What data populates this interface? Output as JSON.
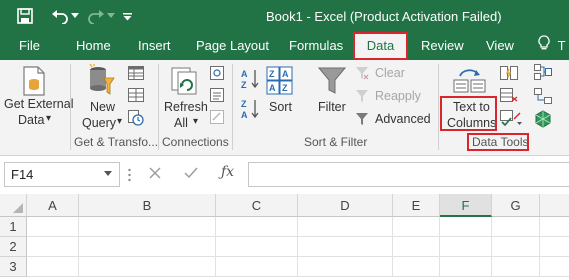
{
  "title_bar": {
    "title": "Book1 - Excel (Product Activation Failed)",
    "icons": [
      "save-icon",
      "undo-icon",
      "undo-dropdown-icon",
      "redo-icon",
      "redo-dropdown-icon",
      "customize-qat-icon"
    ]
  },
  "tabs": [
    {
      "label": "File"
    },
    {
      "label": "Home"
    },
    {
      "label": "Insert"
    },
    {
      "label": "Page Layout"
    },
    {
      "label": "Formulas"
    },
    {
      "label": "Data",
      "active": true
    },
    {
      "label": "Review"
    },
    {
      "label": "View"
    },
    {
      "label": "T"
    }
  ],
  "ribbon": {
    "get_external": {
      "line1": "Get External",
      "line2": "Data",
      "arrow": "▾"
    },
    "new_query": {
      "line1": "New",
      "line2": "Query",
      "arrow": "▾"
    },
    "refresh_all": {
      "line1": "Refresh",
      "line2": "All",
      "arrow": "▾"
    },
    "sort": {
      "label": "Sort"
    },
    "filter": {
      "label": "Filter"
    },
    "clear": {
      "label": "Clear"
    },
    "reapply": {
      "label": "Reapply"
    },
    "advanced": {
      "label": "Advanced"
    },
    "text_to_columns": {
      "line1": "Text to",
      "line2": "Columns"
    },
    "groups": {
      "get_transform": "Get & Transfo...",
      "connections": "Connections",
      "sort_filter": "Sort & Filter",
      "data_tools": "Data Tools"
    },
    "accent_color": "#217346",
    "highlight_color": "#d9262c"
  },
  "formula_bar": {
    "name_box": "F14",
    "formula": ""
  },
  "grid": {
    "columns": [
      "A",
      "B",
      "C",
      "D",
      "E",
      "F",
      "G"
    ],
    "selected_column": "F",
    "rows": [
      "1",
      "2",
      "3"
    ]
  }
}
